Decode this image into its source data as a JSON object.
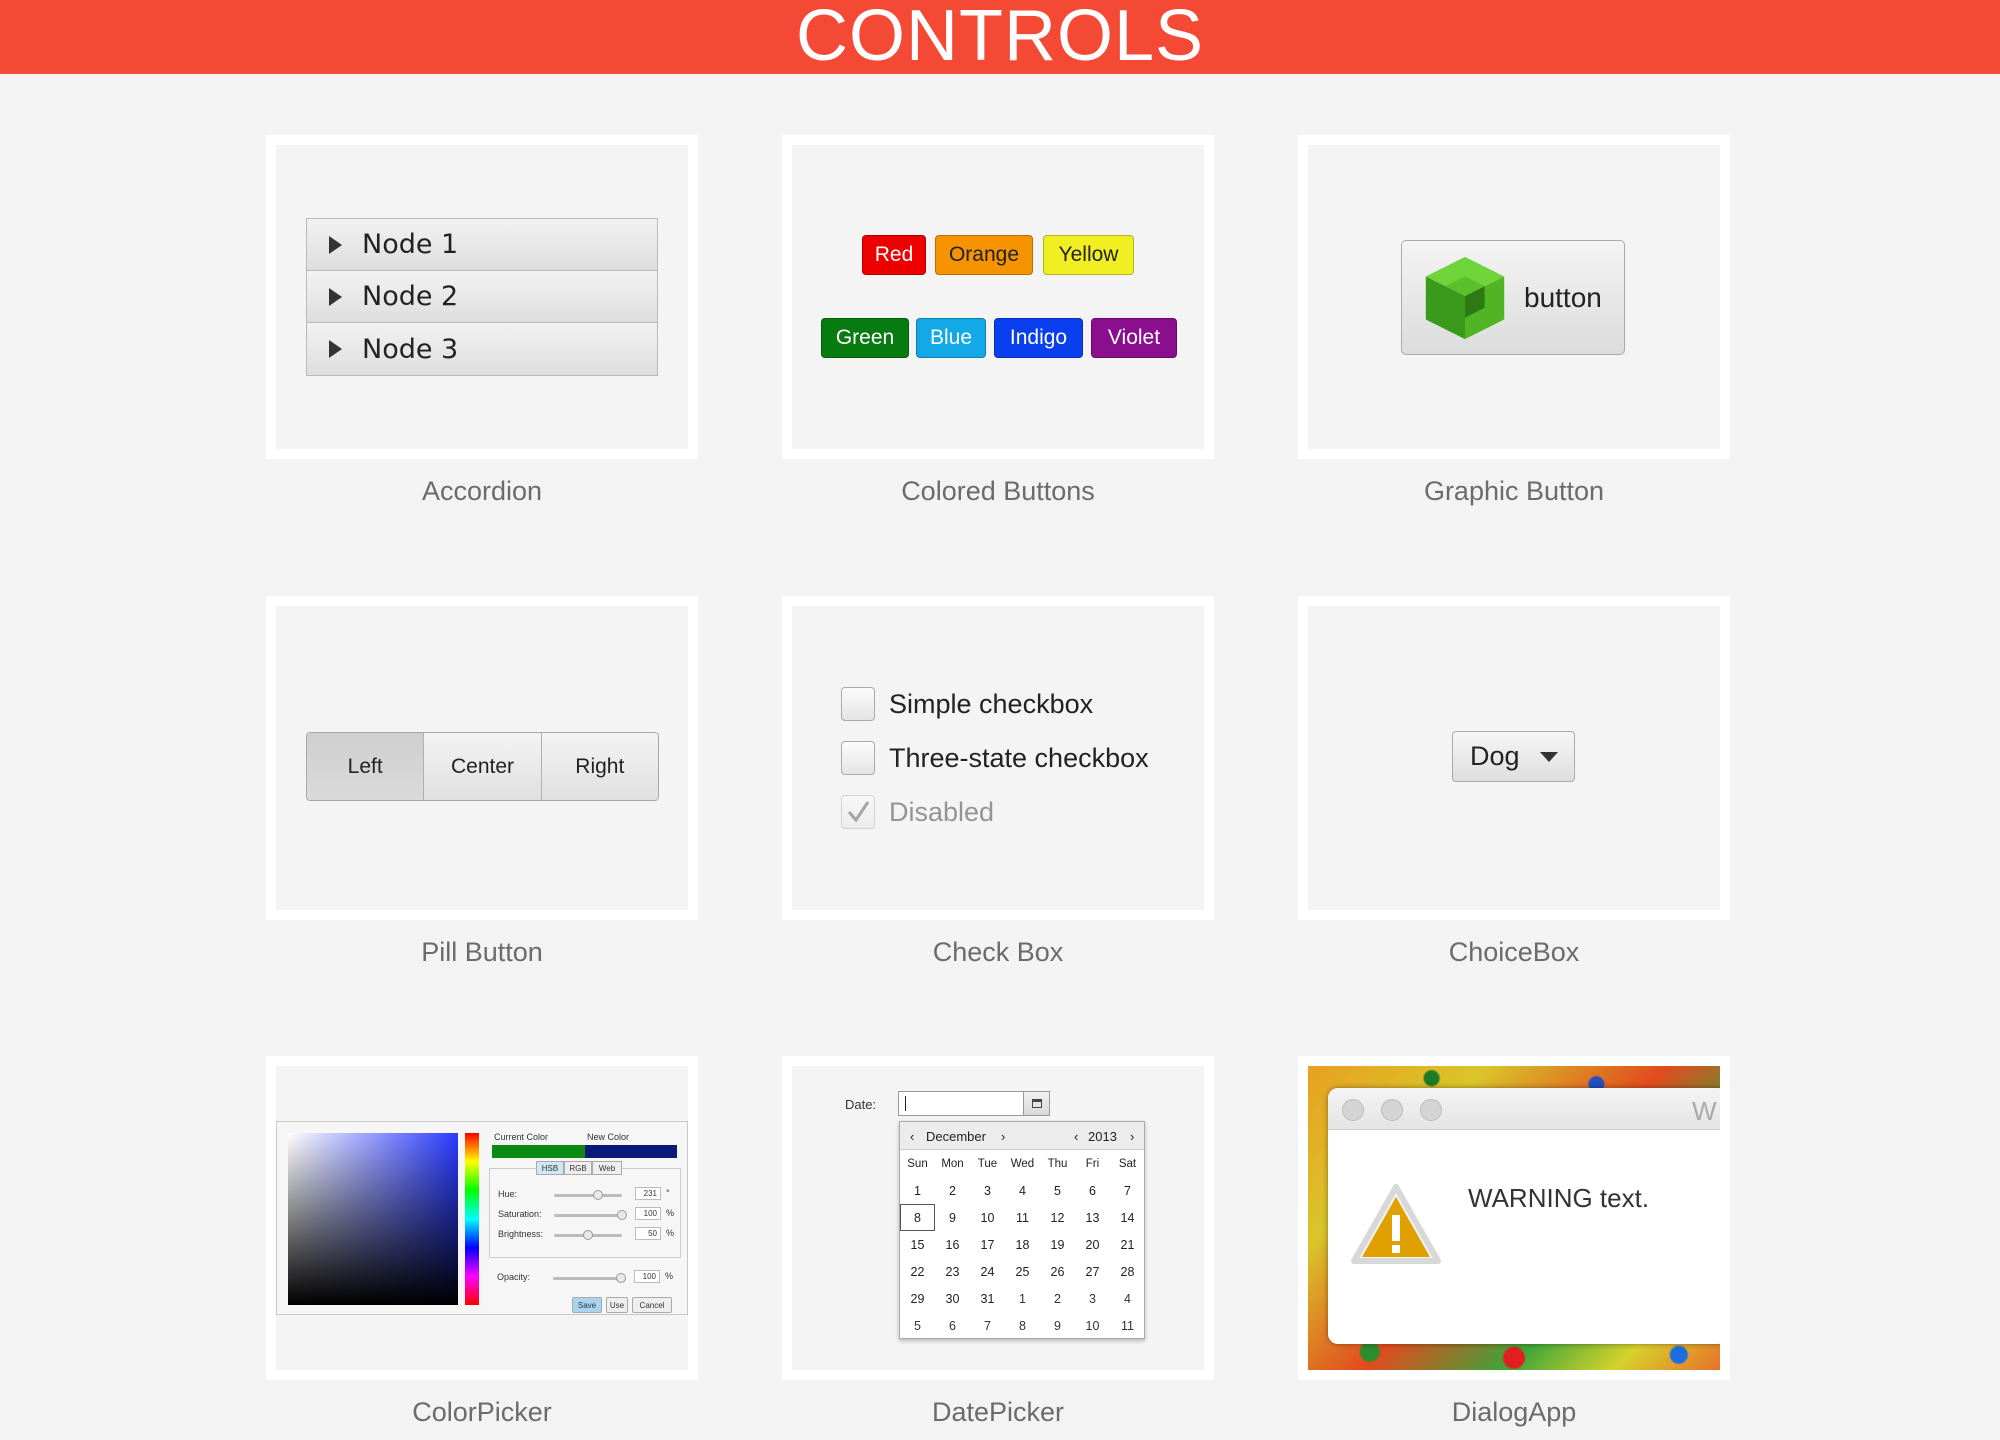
{
  "header": {
    "title": "CONTROLS"
  },
  "tiles": {
    "accordion": {
      "caption": "Accordion",
      "nodes": [
        "Node 1",
        "Node 2",
        "Node 3"
      ]
    },
    "colored_buttons": {
      "caption": "Colored Buttons",
      "buttons": [
        {
          "label": "Red",
          "color": "#ee0000"
        },
        {
          "label": "Orange",
          "color": "#f59400"
        },
        {
          "label": "Yellow",
          "color": "#f1ee22"
        },
        {
          "label": "Green",
          "color": "#077a10"
        },
        {
          "label": "Blue",
          "color": "#13a9e8"
        },
        {
          "label": "Indigo",
          "color": "#0a3ff0"
        },
        {
          "label": "Violet",
          "color": "#8a0e8e"
        }
      ]
    },
    "graphic_button": {
      "caption": "Graphic Button",
      "label": "button",
      "icon": "green-cube-icon"
    },
    "pill_button": {
      "caption": "Pill Button",
      "segments": [
        "Left",
        "Center",
        "Right"
      ],
      "selected": "Left"
    },
    "check_box": {
      "caption": "Check Box",
      "items": [
        {
          "label": "Simple checkbox",
          "checked": false,
          "disabled": false
        },
        {
          "label": "Three-state checkbox",
          "checked": false,
          "disabled": false
        },
        {
          "label": "Disabled",
          "checked": true,
          "disabled": true
        }
      ]
    },
    "choice_box": {
      "caption": "ChoiceBox",
      "value": "Dog"
    },
    "color_picker": {
      "caption": "ColorPicker",
      "current_label": "Current Color",
      "new_label": "New Color",
      "current_color": "#0a8a12",
      "new_color": "#0b1a7a",
      "tabs": [
        "HSB",
        "RGB",
        "Web"
      ],
      "fields": [
        {
          "label": "Hue:",
          "value": "231",
          "unit": "°",
          "level": 0.64
        },
        {
          "label": "Saturation:",
          "value": "100",
          "unit": "%",
          "level": 1.0
        },
        {
          "label": "Brightness:",
          "value": "50",
          "unit": "%",
          "level": 0.5
        }
      ],
      "opacity": {
        "label": "Opacity:",
        "value": "100",
        "unit": "%",
        "level": 1.0
      },
      "buttons": [
        "Save",
        "Use",
        "Cancel"
      ]
    },
    "date_picker": {
      "caption": "DatePicker",
      "label": "Date:",
      "month": "December",
      "year": "2013",
      "days_of_week": [
        "Sun",
        "Mon",
        "Tue",
        "Wed",
        "Thu",
        "Fri",
        "Sat"
      ],
      "weeks": [
        [
          "1",
          "2",
          "3",
          "4",
          "5",
          "6",
          "7"
        ],
        [
          "8",
          "9",
          "10",
          "11",
          "12",
          "13",
          "14"
        ],
        [
          "15",
          "16",
          "17",
          "18",
          "19",
          "20",
          "21"
        ],
        [
          "22",
          "23",
          "24",
          "25",
          "26",
          "27",
          "28"
        ],
        [
          "29",
          "30",
          "31",
          "1",
          "2",
          "3",
          "4"
        ],
        [
          "5",
          "6",
          "7",
          "8",
          "9",
          "10",
          "11"
        ]
      ],
      "today": "8"
    },
    "dialog_app": {
      "caption": "DialogApp",
      "title_fragment": "W",
      "message": "WARNING text."
    }
  }
}
